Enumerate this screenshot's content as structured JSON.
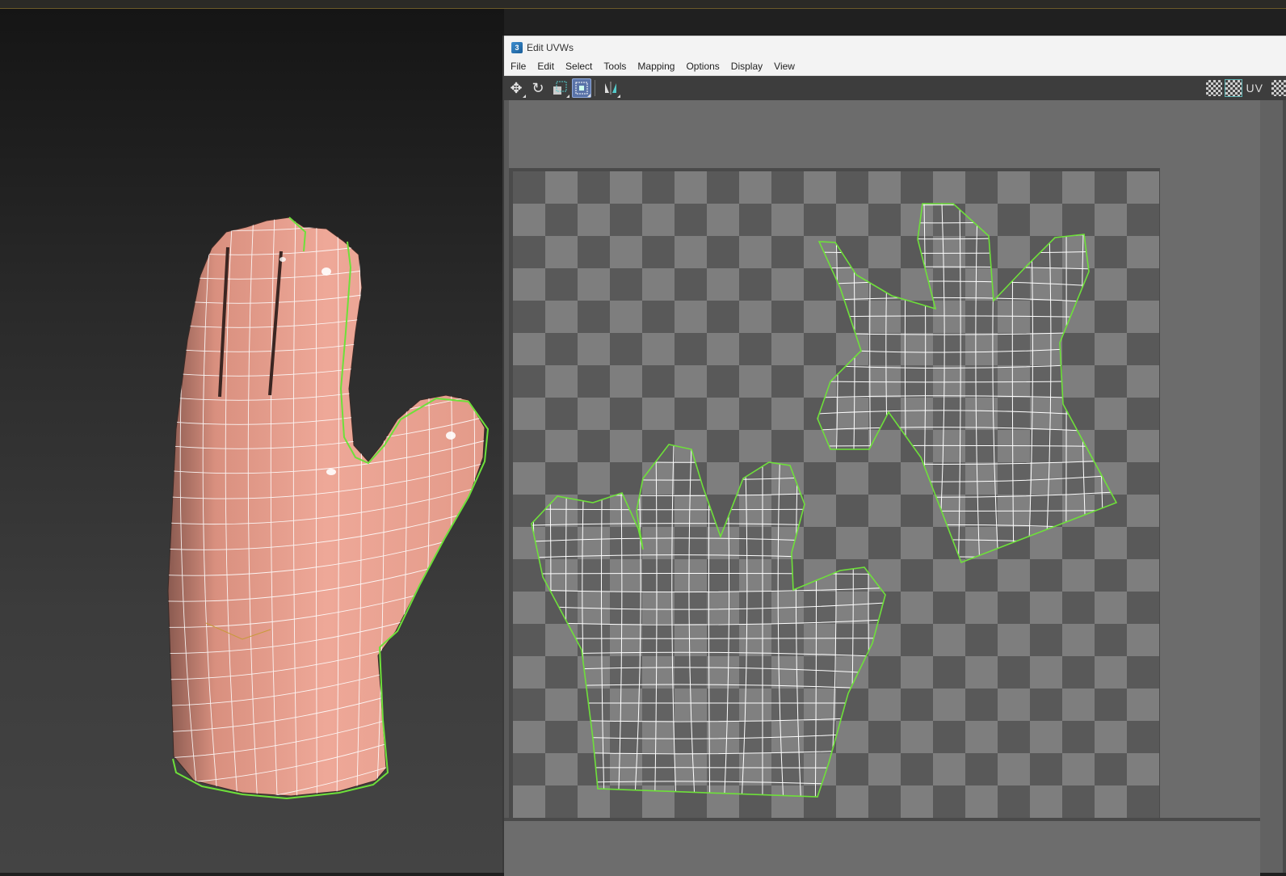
{
  "viewport3d": {
    "object": "hand-mesh",
    "colors": {
      "skin": "#e8a292",
      "wire": "#ffffff",
      "seam": "#6ee03a",
      "background_top": "#151515",
      "background_bottom": "#444444"
    }
  },
  "uvw_window": {
    "title": "Edit UVWs",
    "app_icon_glyph": "3",
    "menu": [
      "File",
      "Edit",
      "Select",
      "Tools",
      "Mapping",
      "Options",
      "Display",
      "View"
    ],
    "toolbar": {
      "left_tools": [
        "move-icon",
        "rotate-icon",
        "scale-icon",
        "freeform-icon",
        "mirror-icon"
      ],
      "active_tool": "freeform-icon",
      "right_tools": [
        "checker-pattern-icon",
        "checker-texture-icon",
        "uv-icon"
      ],
      "uv_label": "UV"
    },
    "editor": {
      "checker_colors": [
        "#7e7e7e",
        "#595959"
      ],
      "seam_color": "#6ee03a",
      "uv_shells": [
        "hand-shell-front",
        "hand-shell-back"
      ]
    }
  }
}
